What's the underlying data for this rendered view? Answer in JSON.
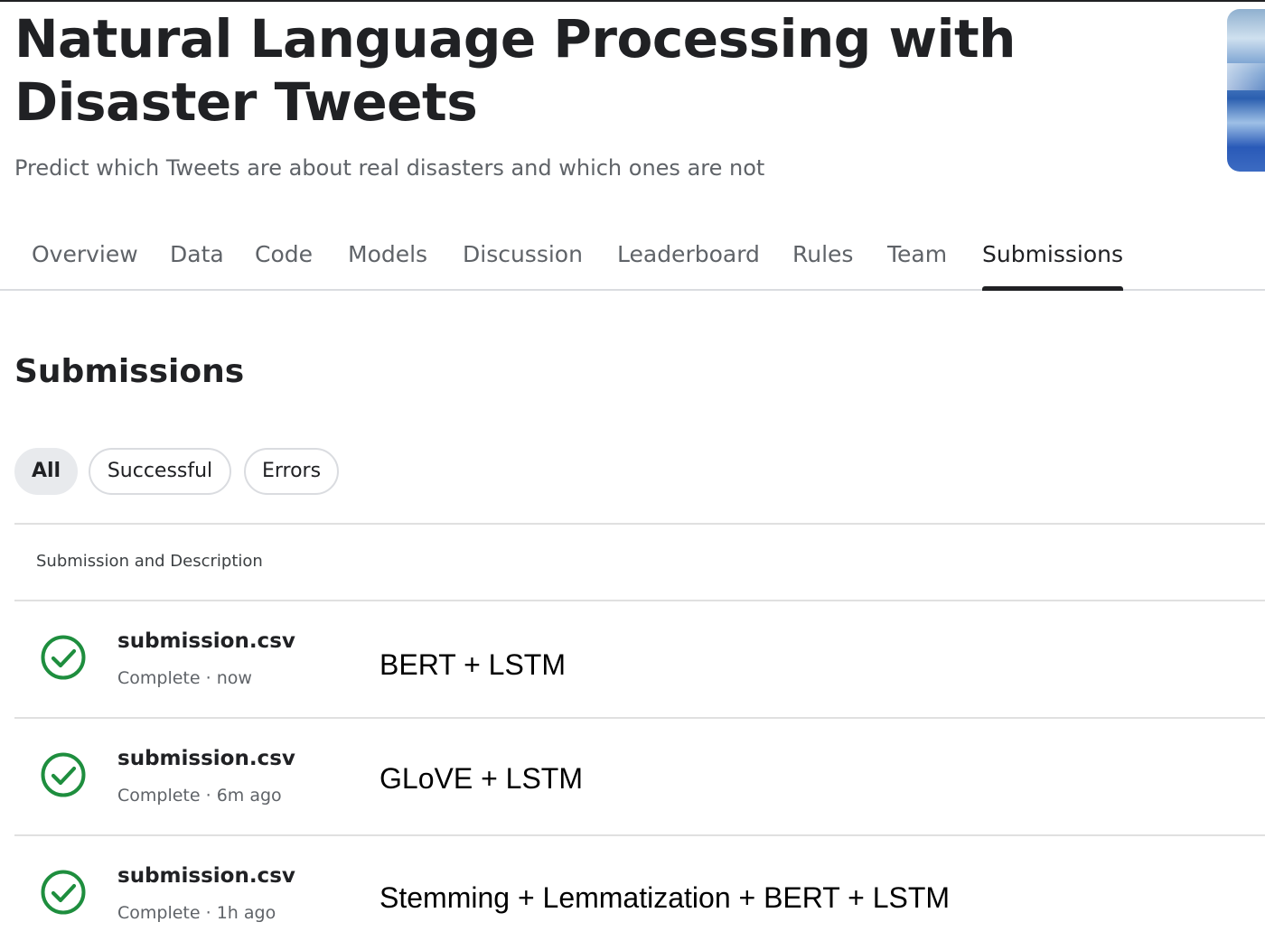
{
  "competition": {
    "title": "Natural Language Processing with Disaster Tweets",
    "subtitle": "Predict which Tweets are about real disasters and which ones are not"
  },
  "tabs": [
    {
      "label": "Overview"
    },
    {
      "label": "Data"
    },
    {
      "label": "Code"
    },
    {
      "label": "Models"
    },
    {
      "label": "Discussion"
    },
    {
      "label": "Leaderboard"
    },
    {
      "label": "Rules"
    },
    {
      "label": "Team"
    },
    {
      "label": "Submissions",
      "active": true
    }
  ],
  "submissions": {
    "heading": "Submissions",
    "filters": [
      {
        "label": "All",
        "active": true
      },
      {
        "label": "Successful"
      },
      {
        "label": "Errors"
      }
    ],
    "column_header": "Submission and Description",
    "rows": [
      {
        "file": "submission.csv",
        "status": "Complete",
        "time": "now",
        "description": "BERT + LSTM",
        "icon": "check-circle-icon"
      },
      {
        "file": "submission.csv",
        "status": "Complete",
        "time": "6m ago",
        "description": "GLoVE + LSTM",
        "icon": "check-circle-icon"
      },
      {
        "file": "submission.csv",
        "status": "Complete",
        "time": "1h ago",
        "description": "Stemming + Lemmatization + BERT + LSTM",
        "icon": "check-circle-icon"
      }
    ]
  },
  "colors": {
    "success": "#1e8e3e",
    "text": "#202124",
    "muted": "#5f6368"
  }
}
